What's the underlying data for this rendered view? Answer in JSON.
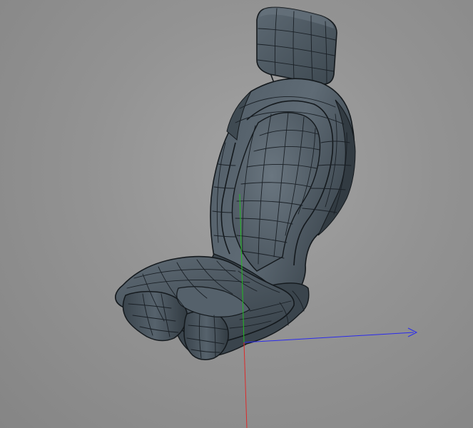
{
  "viewport": {
    "background_color": "#939393",
    "model_surface_color": "#4a5660",
    "model_highlight_color": "#6c7882",
    "wireframe_color": "#1a2026"
  },
  "axes": {
    "x_axis_color": "#2a2aee",
    "y_axis_color": "#22bb22",
    "z_axis_color": "#dd2a2a"
  },
  "model": {
    "icon": "car-seat-mesh"
  }
}
